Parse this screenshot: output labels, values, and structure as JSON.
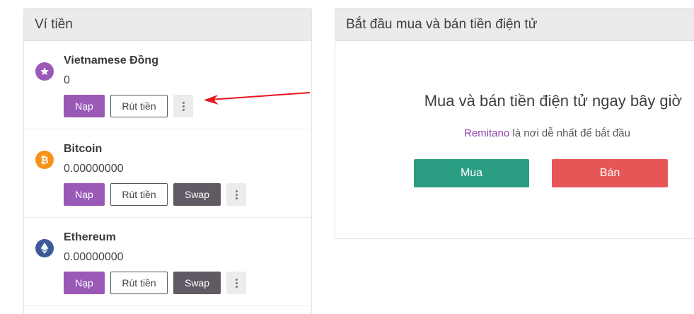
{
  "wallet": {
    "title": "Ví tiền",
    "assets": [
      {
        "name": "Vietnamese Đồng",
        "balance": "0",
        "icon": "star-icon",
        "icon_color": "#9b59b6",
        "deposit_label": "Nạp",
        "withdraw_label": "Rút tiền"
      },
      {
        "name": "Bitcoin",
        "balance": "0.00000000",
        "icon": "bitcoin-icon",
        "icon_color": "#f7931a",
        "deposit_label": "Nạp",
        "withdraw_label": "Rút tiền",
        "swap_label": "Swap"
      },
      {
        "name": "Ethereum",
        "balance": "0.00000000",
        "icon": "ethereum-icon",
        "icon_color": "#3c5a9a",
        "deposit_label": "Nạp",
        "withdraw_label": "Rút tiền",
        "swap_label": "Swap"
      }
    ]
  },
  "start": {
    "title": "Bắt đầu mua và bán tiền điện tử",
    "headline": "Mua và bán tiền điện tử ngay bây giờ",
    "brand": "Remitano",
    "sub_rest": " là nơi dễ nhất để bắt đầu",
    "buy_label": "Mua",
    "sell_label": "Bán"
  },
  "colors": {
    "accent": "#9b59b6",
    "buy": "#2a9d82",
    "sell": "#e55757",
    "swap": "#5f5a63",
    "annotation_arrow": "#e8141e"
  }
}
